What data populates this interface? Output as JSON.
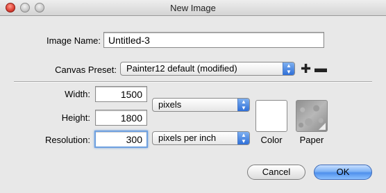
{
  "window": {
    "title": "New Image"
  },
  "image_name": {
    "label": "Image Name:",
    "value": "Untitled-3"
  },
  "canvas_preset": {
    "label": "Canvas Preset:",
    "selected": "Painter12 default (modified)",
    "add_icon": "plus-icon",
    "remove_icon": "minus-icon"
  },
  "size": {
    "width_label": "Width:",
    "width_value": "1500",
    "height_label": "Height:",
    "height_value": "1800",
    "units_selected": "pixels",
    "resolution_label": "Resolution:",
    "resolution_value": "300",
    "resolution_units_selected": "pixels per inch"
  },
  "swatches": {
    "color_label": "Color",
    "color_value": "#ffffff",
    "paper_label": "Paper"
  },
  "buttons": {
    "cancel": "Cancel",
    "ok": "OK"
  }
}
